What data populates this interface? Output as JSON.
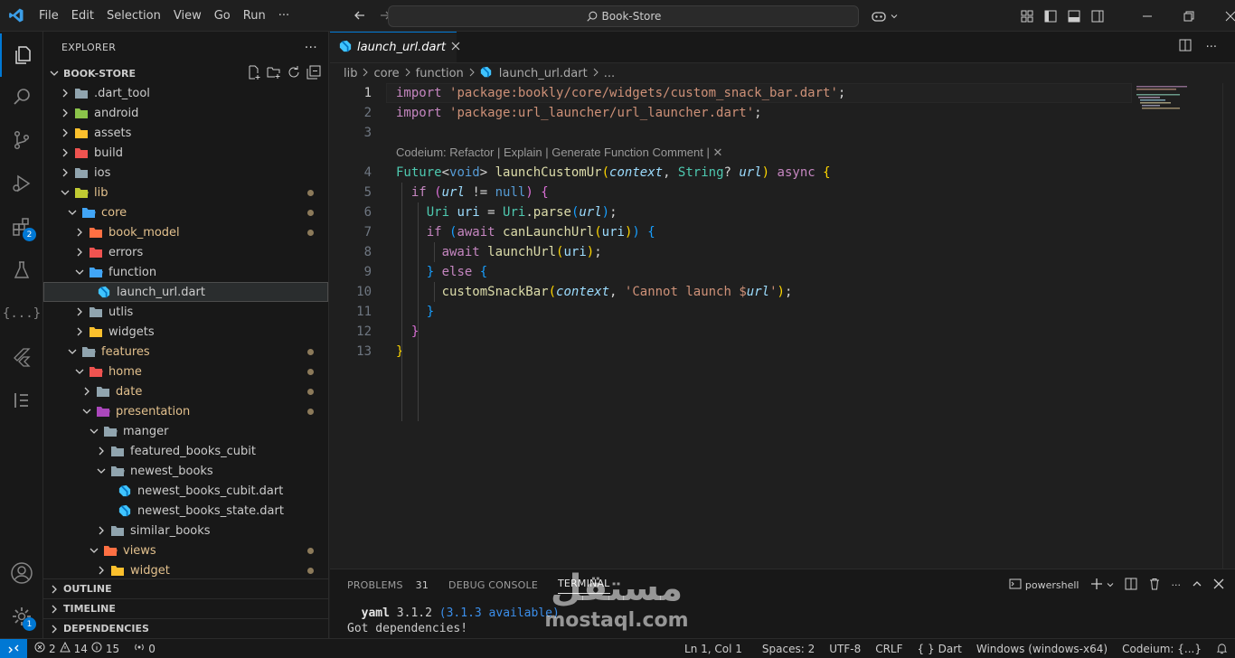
{
  "titlebar": {
    "menu": [
      "File",
      "Edit",
      "Selection",
      "View",
      "Go",
      "Run",
      "···"
    ],
    "search": "Book-Store"
  },
  "activity": {
    "extensions_badge": "2",
    "settings_badge": "1"
  },
  "sidebar": {
    "title": "EXPLORER",
    "more": "···",
    "project": "BOOK-STORE",
    "tree": [
      {
        "label": ".dart_tool",
        "depth": 0,
        "type": "folder",
        "open": false,
        "icon": "folder-grey",
        "mod": false
      },
      {
        "label": "android",
        "depth": 0,
        "type": "folder",
        "open": false,
        "icon": "folder-green",
        "mod": false
      },
      {
        "label": "assets",
        "depth": 0,
        "type": "folder",
        "open": false,
        "icon": "folder-yellow",
        "mod": false
      },
      {
        "label": "build",
        "depth": 0,
        "type": "folder",
        "open": false,
        "icon": "folder-red",
        "mod": false
      },
      {
        "label": "ios",
        "depth": 0,
        "type": "folder",
        "open": false,
        "icon": "folder-grey",
        "mod": false
      },
      {
        "label": "lib",
        "depth": 0,
        "type": "folder",
        "open": true,
        "icon": "folder-lib",
        "mod": true
      },
      {
        "label": "core",
        "depth": 1,
        "type": "folder",
        "open": true,
        "icon": "folder-blue",
        "mod": true
      },
      {
        "label": "book_model",
        "depth": 2,
        "type": "folder",
        "open": false,
        "icon": "folder-orange",
        "mod": true
      },
      {
        "label": "errors",
        "depth": 2,
        "type": "folder",
        "open": false,
        "icon": "folder-red",
        "mod": false
      },
      {
        "label": "function",
        "depth": 2,
        "type": "folder",
        "open": true,
        "icon": "folder-blue",
        "mod": false
      },
      {
        "label": "launch_url.dart",
        "depth": 3,
        "type": "file",
        "icon": "dart",
        "mod": false,
        "selected": true
      },
      {
        "label": "utlis",
        "depth": 2,
        "type": "folder",
        "open": false,
        "icon": "folder-grey",
        "mod": false
      },
      {
        "label": "widgets",
        "depth": 2,
        "type": "folder",
        "open": false,
        "icon": "folder-yellow",
        "mod": false
      },
      {
        "label": "features",
        "depth": 1,
        "type": "folder",
        "open": true,
        "icon": "folder-grey",
        "mod": true
      },
      {
        "label": "home",
        "depth": 2,
        "type": "folder",
        "open": true,
        "icon": "folder-red",
        "mod": true
      },
      {
        "label": "date",
        "depth": 3,
        "type": "folder",
        "open": false,
        "icon": "folder-grey",
        "mod": true
      },
      {
        "label": "presentation",
        "depth": 3,
        "type": "folder",
        "open": true,
        "icon": "folder-purple",
        "mod": true
      },
      {
        "label": "manger",
        "depth": 4,
        "type": "folder",
        "open": true,
        "icon": "folder-grey",
        "mod": false
      },
      {
        "label": "featured_books_cubit",
        "depth": 5,
        "type": "folder",
        "open": false,
        "icon": "folder-grey",
        "mod": false
      },
      {
        "label": "newest_books",
        "depth": 5,
        "type": "folder",
        "open": true,
        "icon": "folder-grey",
        "mod": false
      },
      {
        "label": "newest_books_cubit.dart",
        "depth": 6,
        "type": "file",
        "icon": "dart",
        "mod": false
      },
      {
        "label": "newest_books_state.dart",
        "depth": 6,
        "type": "file",
        "icon": "dart",
        "mod": false
      },
      {
        "label": "similar_books",
        "depth": 5,
        "type": "folder",
        "open": false,
        "icon": "folder-grey",
        "mod": false
      },
      {
        "label": "views",
        "depth": 4,
        "type": "folder",
        "open": true,
        "icon": "folder-orange",
        "mod": true
      },
      {
        "label": "widget",
        "depth": 5,
        "type": "folder",
        "open": false,
        "icon": "folder-yellow",
        "mod": true
      }
    ],
    "sections": [
      "OUTLINE",
      "TIMELINE",
      "DEPENDENCIES"
    ]
  },
  "editor": {
    "tab": "launch_url.dart",
    "breadcrumb": [
      "lib",
      "core",
      "function",
      "launch_url.dart",
      "..."
    ],
    "line_numbers": [
      "1",
      "2",
      "3",
      "4",
      "5",
      "6",
      "7",
      "8",
      "9",
      "10",
      "11",
      "12",
      "13"
    ],
    "codelens": "Codeium: Refactor | Explain | Generate Function Comment | ✕",
    "code": [
      [
        [
          "kw",
          "import"
        ],
        [
          "p",
          " "
        ],
        [
          "str",
          "'package:bookly/core/widgets/custom_snack_bar.dart'"
        ],
        [
          "p",
          ";"
        ]
      ],
      [
        [
          "kw",
          "import"
        ],
        [
          "p",
          " "
        ],
        [
          "str",
          "'package:url_launcher/url_launcher.dart'"
        ],
        [
          "p",
          ";"
        ]
      ],
      [],
      [
        [
          "ty",
          "Future"
        ],
        [
          "p",
          "<"
        ],
        [
          "kw2",
          "void"
        ],
        [
          "p",
          "> "
        ],
        [
          "fn",
          "launchCustomUr"
        ],
        [
          "b1",
          "("
        ],
        [
          "par",
          "context"
        ],
        [
          "p",
          ", "
        ],
        [
          "ty",
          "String"
        ],
        [
          "p",
          "? "
        ],
        [
          "par",
          "url"
        ],
        [
          "b1",
          ")"
        ],
        [
          "p",
          " "
        ],
        [
          "kw",
          "async"
        ],
        [
          "p",
          " "
        ],
        [
          "b1",
          "{"
        ]
      ],
      [
        [
          "p",
          "  "
        ],
        [
          "kw",
          "if"
        ],
        [
          "p",
          " "
        ],
        [
          "b2",
          "("
        ],
        [
          "par",
          "url"
        ],
        [
          "p",
          " != "
        ],
        [
          "kw2",
          "null"
        ],
        [
          "b2",
          ")"
        ],
        [
          "p",
          " "
        ],
        [
          "b2",
          "{"
        ]
      ],
      [
        [
          "p",
          "    "
        ],
        [
          "ty",
          "Uri"
        ],
        [
          "p",
          " "
        ],
        [
          "var",
          "uri"
        ],
        [
          "p",
          " = "
        ],
        [
          "ty",
          "Uri"
        ],
        [
          "p",
          "."
        ],
        [
          "fn",
          "parse"
        ],
        [
          "b3",
          "("
        ],
        [
          "par",
          "url"
        ],
        [
          "b3",
          ")"
        ],
        [
          "p",
          ";"
        ]
      ],
      [
        [
          "p",
          "    "
        ],
        [
          "kw",
          "if"
        ],
        [
          "p",
          " "
        ],
        [
          "b3",
          "("
        ],
        [
          "kw",
          "await"
        ],
        [
          "p",
          " "
        ],
        [
          "fn",
          "canLaunchUrl"
        ],
        [
          "b1",
          "("
        ],
        [
          "var",
          "uri"
        ],
        [
          "b1",
          ")"
        ],
        [
          "b3",
          ")"
        ],
        [
          "p",
          " "
        ],
        [
          "b3",
          "{"
        ]
      ],
      [
        [
          "p",
          "      "
        ],
        [
          "kw",
          "await"
        ],
        [
          "p",
          " "
        ],
        [
          "fn",
          "launchUrl"
        ],
        [
          "b1",
          "("
        ],
        [
          "var",
          "uri"
        ],
        [
          "b1",
          ")"
        ],
        [
          "p",
          ";"
        ]
      ],
      [
        [
          "p",
          "    "
        ],
        [
          "b3",
          "}"
        ],
        [
          "p",
          " "
        ],
        [
          "kw",
          "else"
        ],
        [
          "p",
          " "
        ],
        [
          "b3",
          "{"
        ]
      ],
      [
        [
          "p",
          "      "
        ],
        [
          "fn",
          "customSnackBar"
        ],
        [
          "b1",
          "("
        ],
        [
          "par",
          "context"
        ],
        [
          "p",
          ", "
        ],
        [
          "str",
          "'Cannot launch $"
        ],
        [
          "par",
          "url"
        ],
        [
          "str",
          "'"
        ],
        [
          "b1",
          ")"
        ],
        [
          "p",
          ";"
        ]
      ],
      [
        [
          "p",
          "    "
        ],
        [
          "b3",
          "}"
        ]
      ],
      [
        [
          "p",
          "  "
        ],
        [
          "b2",
          "}"
        ]
      ],
      [
        [
          "b1",
          "}"
        ]
      ]
    ]
  },
  "panel": {
    "tabs": [
      {
        "label": "PROBLEMS",
        "count": "31"
      },
      {
        "label": "DEBUG CONSOLE",
        "count": ""
      },
      {
        "label": "TERMINAL",
        "count": ""
      }
    ],
    "shell": "powershell",
    "terminal": [
      [
        [
          "b",
          "  yaml"
        ],
        [
          "n",
          " 3.1.2 "
        ],
        [
          "c",
          "(3.1.3 available)"
        ]
      ],
      [
        [
          "n",
          "Got dependencies!"
        ]
      ]
    ]
  },
  "watermark": {
    "arabic": "مستقل",
    "latin": "mostaql.com"
  },
  "status": {
    "errors": "2",
    "warnings": "14",
    "infos": "15",
    "ports": "0",
    "position": "Ln 1, Col 1",
    "spaces": "Spaces: 2",
    "encoding": "UTF-8",
    "eol": "CRLF",
    "language": "Dart",
    "platform": "Windows (windows-x64)",
    "codeium": "Codeium: {...}"
  }
}
